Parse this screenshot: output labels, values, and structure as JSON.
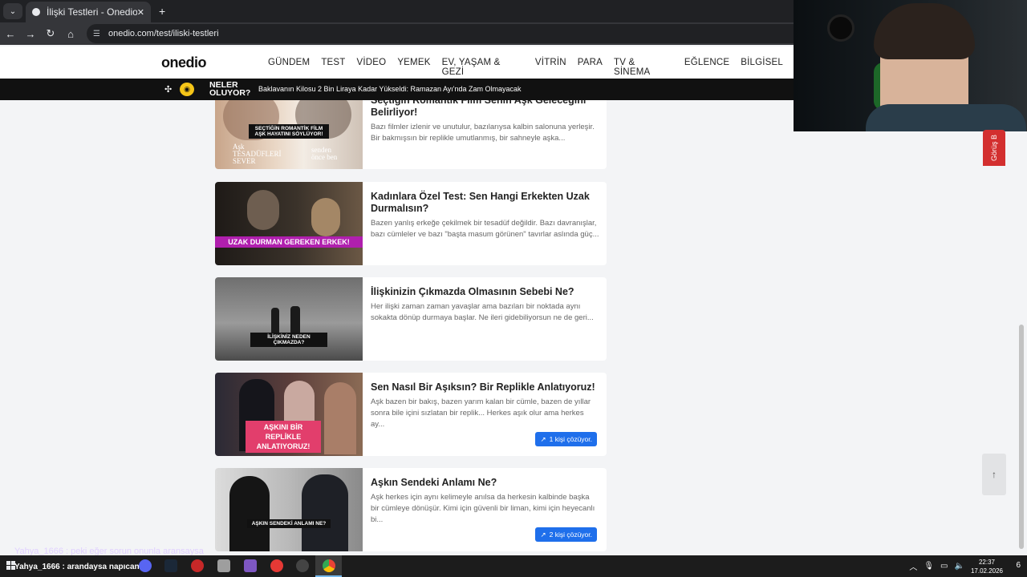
{
  "browser": {
    "tab_title": "İlişki Testleri - Onedio",
    "url": "onedio.com/test/iliski-testleri"
  },
  "site": {
    "logo": "onedio",
    "nav": [
      "GÜNDEM",
      "TEST",
      "VİDEO",
      "YEMEK",
      "EV, YAŞAM & GEZİ",
      "VİTRİN",
      "PARA",
      "TV & SİNEMA",
      "EĞLENCE",
      "BİLGİSEL"
    ],
    "ticker_label_line1": "NELER",
    "ticker_label_line2": "OLUYOR?",
    "ticker_headline": "Baklavanın Kilosu 2 Bin Liraya Kadar Yükseldi: Ramazan Ayı'nda Zam Olmayacak"
  },
  "cards": [
    {
      "title": "Seçtiğin Romantik Film Senin Aşk Geleceğini Belirliyor!",
      "desc": "Bazı filmler izlenir ve unutulur, bazılarıysa kalbin salonuna yerleşir. Bir bakmışsın bir replikle umutlanmış, bir sahneyle aşka...",
      "thumb_caption": "SEÇTİĞİN ROMANTİK FİLM AŞK HAYATINI SÖYLÜYOR!",
      "thumb_poster_left": "Aşk TESADÜFLERİ SEVER",
      "thumb_poster_right": "senden önce ben"
    },
    {
      "title": "Kadınlara Özel Test: Sen Hangi Erkekten Uzak Durmalısın?",
      "desc": "Bazen yanlış erkeğe çekilmek bir tesadüf değildir. Bazı davranışlar, bazı cümleler ve bazı \"başta masum görünen\" tavırlar aslında güç...",
      "thumb_caption": "UZAK DURMAN GEREKEN ERKEK!"
    },
    {
      "title": "İlişkinizin Çıkmazda Olmasının Sebebi Ne?",
      "desc": "Her ilişki zaman zaman yavaşlar ama bazıları bir noktada aynı sokakta dönüp durmaya başlar. Ne ileri gidebiliyorsun ne de geri...",
      "thumb_caption": "İLİŞKİNİZ NEDEN ÇIKMAZDA?"
    },
    {
      "title": "Sen Nasıl Bir Aşıksın? Bir Replikle Anlatıyoruz!",
      "desc": "Aşk bazen bir bakış, bazen yarım kalan bir cümle, bazen de yıllar sonra bile içini sızlatan bir replik... Herkes aşık olur ama herkes ay...",
      "thumb_caption": "AŞKINI BİR REPLİKLE ANLATIYORUZ!",
      "badge": "1 kişi çözüyor."
    },
    {
      "title": "Aşkın Sendeki Anlamı Ne?",
      "desc": "Aşk herkes için aynı kelimeyle anılsa da herkesin kalbinde başka bir cümleye dönüşür. Kimi için güvenli bir liman, kimi için heyecanlı bi...",
      "thumb_caption": "AŞKIN SENDEKİ ANLAMI NE?",
      "badge": "2 kişi çözüyor."
    }
  ],
  "side": {
    "feedback_label": "Görüş B"
  },
  "taskbar": {
    "time": "22:37",
    "date": "17.02.2026",
    "notif_count": "6"
  },
  "overlay": {
    "chat_line": "Yahya_1666 : peki eğer sorun onunla aransaysa",
    "stream_user": "Yahya_1666 : arandaysa napıcan"
  },
  "colors": {
    "badge": "#1f6feb",
    "feedback": "#d32f2f",
    "ticker_bg": "#111111"
  }
}
